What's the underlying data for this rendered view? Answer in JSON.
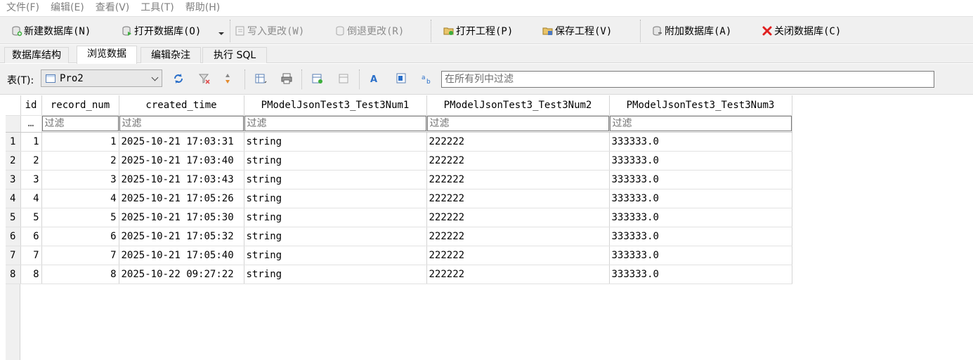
{
  "menu": [
    "文件(F)",
    "编辑(E)",
    "查看(V)",
    "工具(T)",
    "帮助(H)"
  ],
  "toolbar": {
    "new_db": "新建数据库(N)",
    "open_db": "打开数据库(O)",
    "write_changes": "写入更改(W)",
    "revert_changes": "倒退更改(R)",
    "open_project": "打开工程(P)",
    "save_project": "保存工程(V)",
    "attach_db": "附加数据库(A)",
    "close_db": "关闭数据库(C)"
  },
  "tabs": [
    "数据库结构",
    "浏览数据",
    "编辑杂注",
    "执行 SQL"
  ],
  "active_tab": "浏览数据",
  "browse": {
    "table_label": "表(T):",
    "table_name": "Pro2",
    "filter_all_placeholder": "在所有列中过滤"
  },
  "grid": {
    "columns": [
      "id",
      "record_num",
      "created_time",
      "PModelJsonTest3_Test3Num1",
      "PModelJsonTest3_Test3Num2",
      "PModelJsonTest3_Test3Num3"
    ],
    "filter_corner": "…",
    "filter_placeholder": "过滤",
    "rows": [
      [
        "1",
        "1",
        "1",
        "2025-10-21 17:03:31",
        "string",
        "222222",
        "333333.0"
      ],
      [
        "2",
        "2",
        "2",
        "2025-10-21 17:03:40",
        "string",
        "222222",
        "333333.0"
      ],
      [
        "3",
        "3",
        "3",
        "2025-10-21 17:03:43",
        "string",
        "222222",
        "333333.0"
      ],
      [
        "4",
        "4",
        "4",
        "2025-10-21 17:05:26",
        "string",
        "222222",
        "333333.0"
      ],
      [
        "5",
        "5",
        "5",
        "2025-10-21 17:05:30",
        "string",
        "222222",
        "333333.0"
      ],
      [
        "6",
        "6",
        "6",
        "2025-10-21 17:05:32",
        "string",
        "222222",
        "333333.0"
      ],
      [
        "7",
        "7",
        "7",
        "2025-10-21 17:05:40",
        "string",
        "222222",
        "333333.0"
      ],
      [
        "8",
        "8",
        "8",
        "2025-10-22 09:27:22",
        "string",
        "222222",
        "333333.0"
      ]
    ]
  },
  "icons": {
    "new_db": "new-database-icon",
    "open_db": "open-database-icon",
    "write_changes": "write-changes-icon",
    "revert_changes": "revert-changes-icon",
    "open_project": "open-project-icon",
    "save_project": "save-project-icon",
    "attach_db": "attach-database-icon",
    "close_db": "close-database-icon"
  },
  "colors": {
    "close_x": "#e02020",
    "refresh": "#2a6fc9",
    "toolbar_bg": "#f0f0f0"
  }
}
